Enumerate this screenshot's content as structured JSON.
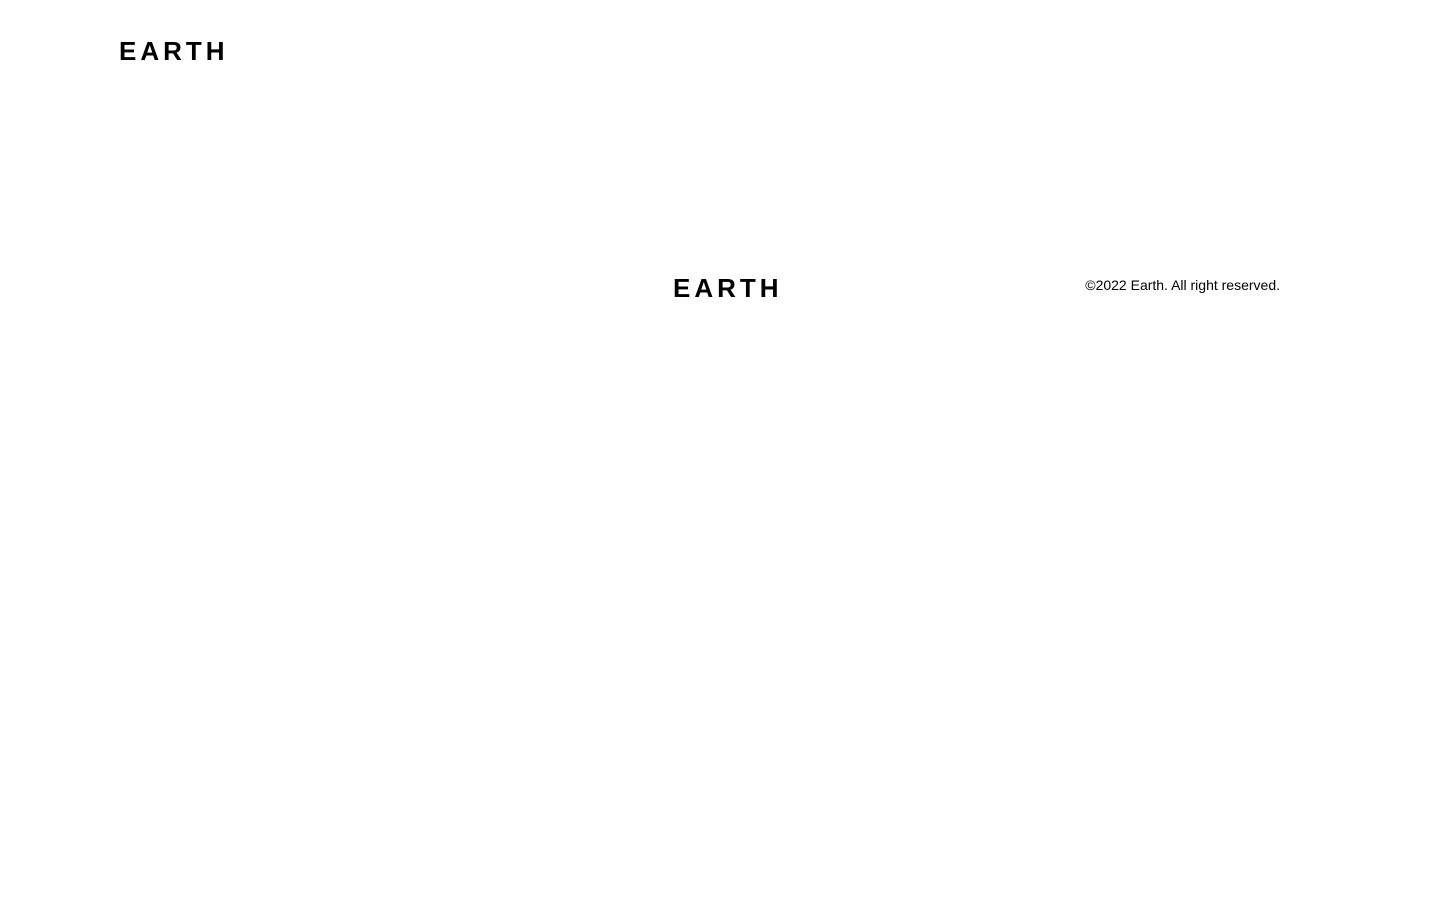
{
  "header": {
    "logo_text": "EARTH"
  },
  "footer": {
    "logo_text": "EARTH",
    "copyright": "©2022 Earth. All right reserved."
  },
  "colors": {
    "background": "#ffffff",
    "text": "#000000"
  }
}
